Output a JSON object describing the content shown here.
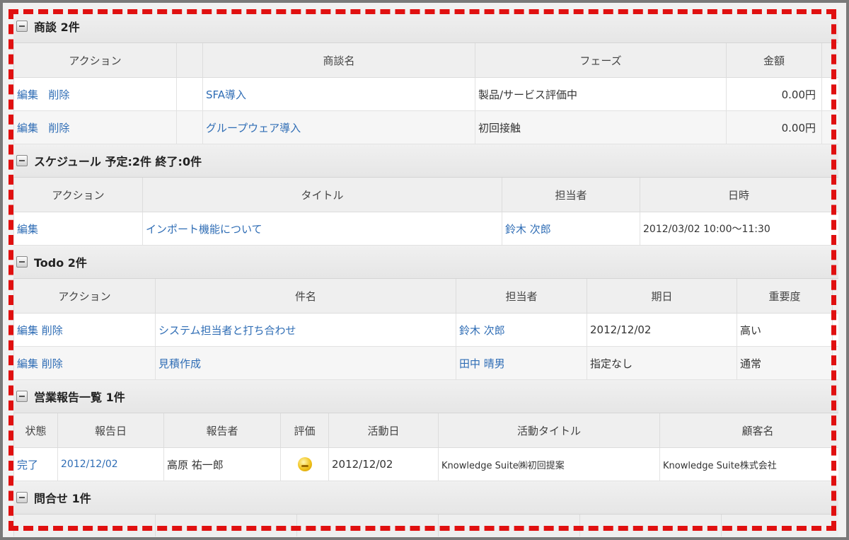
{
  "deals": {
    "header": "商談 2件",
    "columns": [
      "アクション",
      "",
      "商談名",
      "フェーズ",
      "金額"
    ],
    "rows": [
      {
        "edit": "編集",
        "delete": "削除",
        "name": "SFA導入",
        "phase": "製品/サービス評価中",
        "amount": "0.00円"
      },
      {
        "edit": "編集",
        "delete": "削除",
        "name": "グループウェア導入",
        "phase": "初回接触",
        "amount": "0.00円"
      }
    ]
  },
  "schedule": {
    "header": "スケジュール 予定:2件  終了:0件",
    "columns": [
      "アクション",
      "タイトル",
      "担当者",
      "日時"
    ],
    "rows": [
      {
        "edit": "編集",
        "title": "インポート機能について",
        "owner": "鈴木 次郎",
        "datetime": "2012/03/02 10:00～11:30"
      }
    ]
  },
  "todo": {
    "header": "Todo 2件",
    "columns": [
      "アクション",
      "件名",
      "担当者",
      "期日",
      "重要度"
    ],
    "rows": [
      {
        "edit": "編集",
        "delete": "削除",
        "subject": "システム担当者と打ち合わせ",
        "owner": "鈴木 次郎",
        "due": "2012/12/02",
        "priority": "高い"
      },
      {
        "edit": "編集",
        "delete": "削除",
        "subject": "見積作成",
        "owner": "田中 晴男",
        "due": "指定なし",
        "priority": "通常"
      }
    ]
  },
  "reports": {
    "header": "営業報告一覧 1件",
    "columns": [
      "状態",
      "報告日",
      "報告者",
      "評価",
      "活動日",
      "活動タイトル",
      "顧客名"
    ],
    "rows": [
      {
        "status": "完了",
        "report_date": "2012/12/02",
        "reporter": "高原 祐一郎",
        "rating_icon": "smile-icon",
        "activity_date": "2012/12/02",
        "activity_title": "Knowledge Suite㈱初回提案",
        "customer": "Knowledge Suite株式会社"
      }
    ]
  },
  "inquiries": {
    "header": "問合せ 1件"
  },
  "colors": {
    "link": "#2f6db5",
    "dash": "#e01010"
  }
}
